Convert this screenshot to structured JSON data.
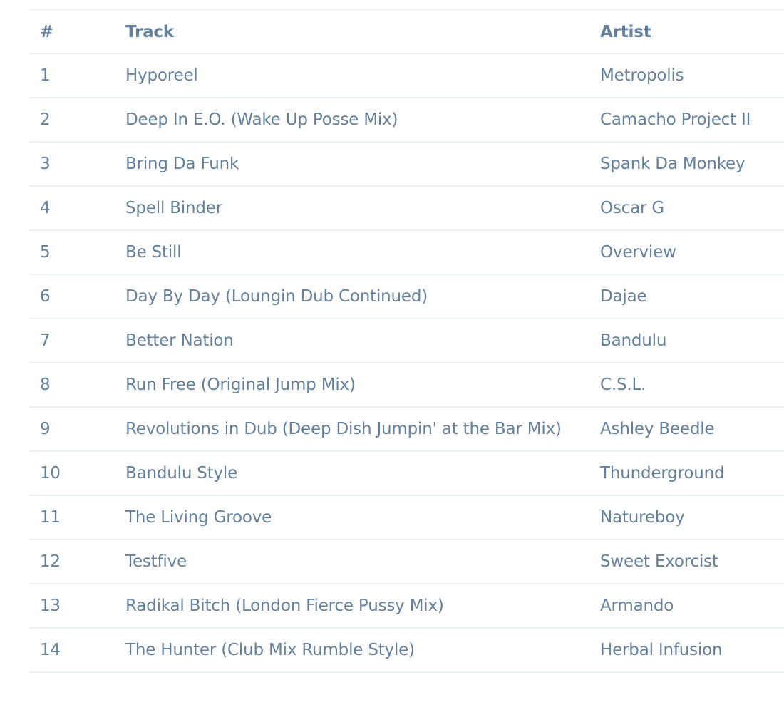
{
  "table": {
    "headers": {
      "number": "#",
      "track": "Track",
      "artist": "Artist"
    },
    "rows": [
      {
        "number": "1",
        "track": "Hyporeel",
        "artist": "Metropolis"
      },
      {
        "number": "2",
        "track": "Deep In E.O. (Wake Up Posse Mix)",
        "artist": "Camacho Project II"
      },
      {
        "number": "3",
        "track": "Bring Da Funk",
        "artist": "Spank Da Monkey"
      },
      {
        "number": "4",
        "track": "Spell Binder",
        "artist": "Oscar G"
      },
      {
        "number": "5",
        "track": "Be Still",
        "artist": "Overview"
      },
      {
        "number": "6",
        "track": "Day By Day (Loungin Dub Continued)",
        "artist": "Dajae"
      },
      {
        "number": "7",
        "track": "Better Nation",
        "artist": "Bandulu"
      },
      {
        "number": "8",
        "track": "Run Free (Original Jump Mix)",
        "artist": "C.S.L."
      },
      {
        "number": "9",
        "track": "Revolutions in Dub (Deep Dish Jumpin' at the Bar Mix)",
        "artist": "Ashley Beedle"
      },
      {
        "number": "10",
        "track": "Bandulu Style",
        "artist": "Thunderground"
      },
      {
        "number": "11",
        "track": "The Living Groove",
        "artist": "Natureboy"
      },
      {
        "number": "12",
        "track": "Testfive",
        "artist": "Sweet Exorcist"
      },
      {
        "number": "13",
        "track": "Radikal Bitch (London Fierce Pussy Mix)",
        "artist": "Armando"
      },
      {
        "number": "14",
        "track": "The Hunter (Club Mix Rumble Style)",
        "artist": "Herbal Infusion"
      }
    ]
  },
  "colors": {
    "text": "#64809a",
    "row_border": "#edf1f5",
    "top_border": "#f1f3f5",
    "background": "#ffffff"
  }
}
